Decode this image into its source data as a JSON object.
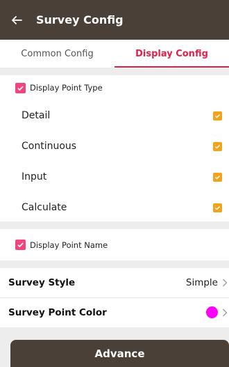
{
  "appbar": {
    "title": "Survey Config",
    "back_icon": "arrow-left-icon"
  },
  "tabs": [
    {
      "label": "Common Config",
      "active": false
    },
    {
      "label": "Display Config",
      "active": true
    }
  ],
  "point_type": {
    "label": "Display Point Type",
    "checked": true,
    "items": [
      {
        "label": "Detail",
        "checked": true
      },
      {
        "label": "Continuous",
        "checked": true
      },
      {
        "label": "Input",
        "checked": true
      },
      {
        "label": "Calculate",
        "checked": true
      }
    ]
  },
  "point_name": {
    "label": "Display Point Name",
    "checked": true
  },
  "survey_style": {
    "label": "Survey Style",
    "value": "Simple"
  },
  "survey_point_color": {
    "label": "Survey Point Color",
    "color": "#ff00ff"
  },
  "advance_button": {
    "label": "Advance"
  },
  "colors": {
    "appbar": "#4a4038",
    "accent": "#e0224a",
    "checkbox_pink": "#f2447e",
    "checkbox_orange": "#f3a21c"
  }
}
